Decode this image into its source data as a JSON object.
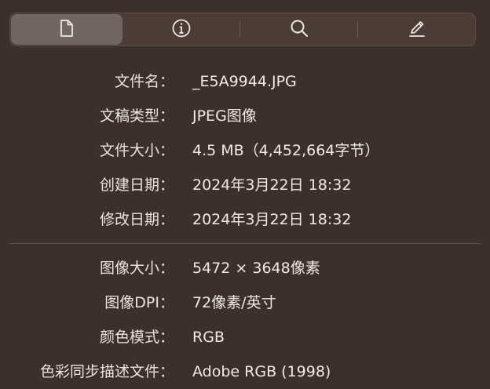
{
  "tabs": [
    {
      "name": "tab-general",
      "icon": "document-icon",
      "active": true
    },
    {
      "name": "tab-info",
      "icon": "info-icon",
      "active": false
    },
    {
      "name": "tab-search",
      "icon": "search-icon",
      "active": false
    },
    {
      "name": "tab-edit",
      "icon": "pencil-icon",
      "active": false
    }
  ],
  "file_info": {
    "filename": {
      "label": "文件名：",
      "value": "_E5A9944.JPG"
    },
    "doc_type": {
      "label": "文稿类型：",
      "value": "JPEG图像"
    },
    "file_size": {
      "label": "文件大小：",
      "value": "4.5 MB（4,452,664字节）"
    },
    "created": {
      "label": "创建日期：",
      "value": "2024年3月22日 18:32"
    },
    "modified": {
      "label": "修改日期：",
      "value": "2024年3月22日 18:32"
    }
  },
  "image_info": {
    "image_size": {
      "label": "图像大小：",
      "value": "5472 × 3648像素"
    },
    "image_dpi": {
      "label": "图像DPI：",
      "value": "72像素/英寸"
    },
    "color_model": {
      "label": "颜色模式：",
      "value": "RGB"
    },
    "color_profile": {
      "label": "色彩同步描述文件：",
      "value": "Adobe RGB (1998)"
    }
  },
  "colors": {
    "background": "#3d2f2a",
    "tabbar": "#4b3c36",
    "active_tab": "#716660",
    "text": "#e9e4e1"
  }
}
